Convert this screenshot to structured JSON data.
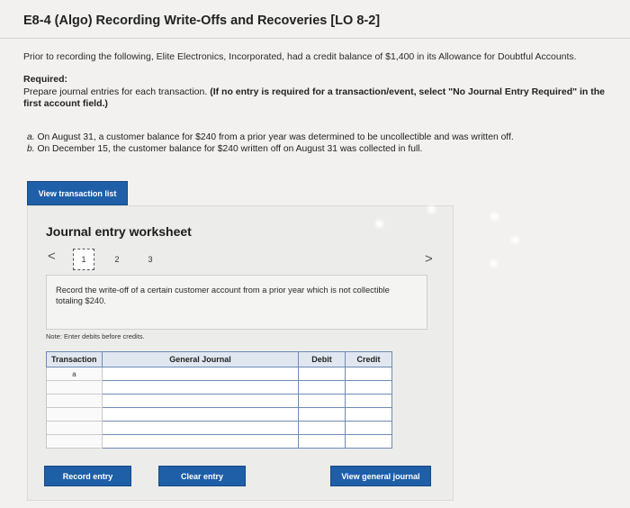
{
  "header": {
    "title": "E8-4 (Algo) Recording Write-Offs and Recoveries [LO 8-2]"
  },
  "problem": {
    "intro": "Prior to recording the following, Elite Electronics, Incorporated, had a credit balance of $1,400 in its Allowance for Doubtful Accounts.",
    "required_heading": "Required:",
    "required_text": "Prepare journal entries for each transaction. ",
    "required_bold": "(If no entry is required for a transaction/event, select \"No Journal Entry Required\" in the first account field.)",
    "item_a_letter": "a.",
    "item_a_text": " On August 31, a customer balance for $240 from a prior year was determined to be uncollectible and was written off.",
    "item_b_letter": "b.",
    "item_b_text": " On December 15, the customer balance for $240 written off on August 31 was collected in full."
  },
  "buttons": {
    "view_transaction_list": "View transaction list",
    "record_entry": "Record entry",
    "clear_entry": "Clear entry",
    "view_general_journal": "View general journal"
  },
  "worksheet": {
    "title": "Journal entry worksheet",
    "nav_prev": "<",
    "nav_next": ">",
    "pages": [
      "1",
      "2",
      "3"
    ],
    "active_page": "1",
    "description": "Record the write-off of a certain customer account from a prior year which is not collectible totaling $240.",
    "note": "Note: Enter debits before credits."
  },
  "journal_table": {
    "headers": {
      "transaction": "Transaction",
      "general_journal": "General Journal",
      "debit": "Debit",
      "credit": "Credit"
    },
    "rows": [
      {
        "transaction": "a",
        "account": "",
        "debit": "",
        "credit": ""
      },
      {
        "transaction": "",
        "account": "",
        "debit": "",
        "credit": ""
      },
      {
        "transaction": "",
        "account": "",
        "debit": "",
        "credit": ""
      },
      {
        "transaction": "",
        "account": "",
        "debit": "",
        "credit": ""
      },
      {
        "transaction": "",
        "account": "",
        "debit": "",
        "credit": ""
      },
      {
        "transaction": "",
        "account": "",
        "debit": "",
        "credit": ""
      }
    ]
  },
  "colors": {
    "accent": "#1f5fa8",
    "table_border": "#6d8bb5",
    "table_header_bg": "#e1e7f0"
  }
}
